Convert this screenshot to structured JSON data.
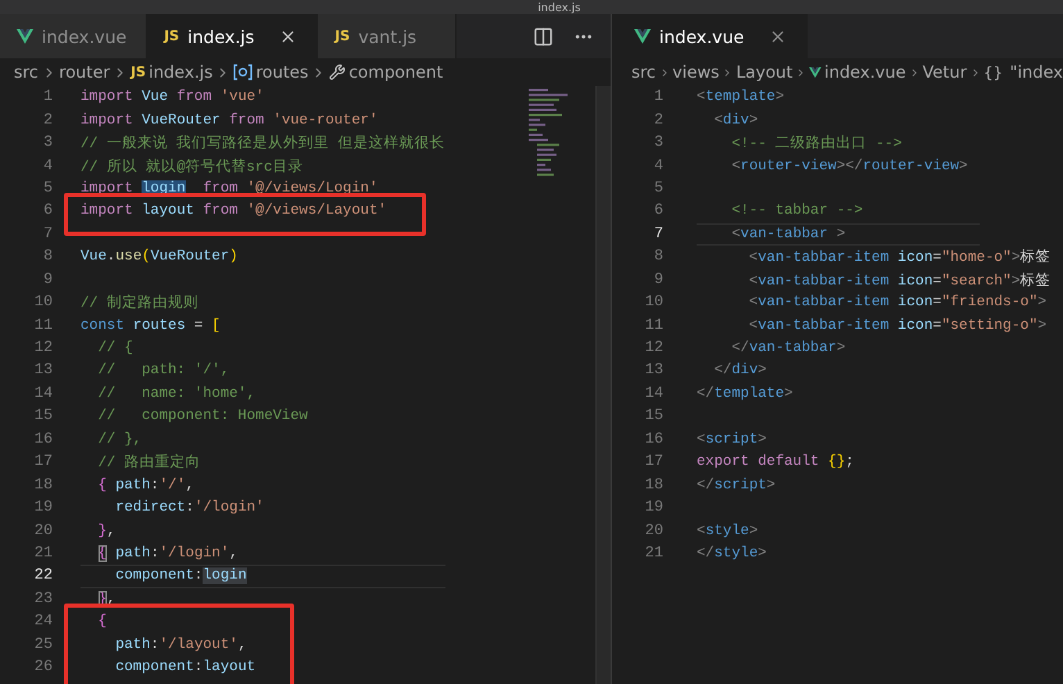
{
  "window": {
    "title": "index.js"
  },
  "left_editor": {
    "tabs": [
      {
        "kind": "vue",
        "label": "index.vue",
        "selected": false
      },
      {
        "kind": "js",
        "badge": "JS",
        "label": "index.js",
        "selected": true
      },
      {
        "kind": "js",
        "badge": "JS",
        "label": "vant.js",
        "selected": false
      }
    ],
    "breadcrumbs": [
      {
        "kind": "folder",
        "text": "src"
      },
      {
        "kind": "folder",
        "text": "router"
      },
      {
        "kind": "js",
        "badge": "JS",
        "text": "index.js"
      },
      {
        "kind": "variable",
        "text": "routes"
      },
      {
        "kind": "property",
        "text": "component"
      }
    ],
    "lines": [
      {
        "n": "1",
        "current": false,
        "marked": false,
        "tokens": [
          {
            "kind": "kw",
            "text": "import "
          },
          {
            "kind": "var",
            "text": "Vue "
          },
          {
            "kind": "kw",
            "text": "from "
          },
          {
            "kind": "str",
            "text": "'vue'"
          }
        ]
      },
      {
        "n": "2",
        "current": false,
        "marked": false,
        "tokens": [
          {
            "kind": "kw",
            "text": "import "
          },
          {
            "kind": "var",
            "text": "VueRouter "
          },
          {
            "kind": "kw",
            "text": "from "
          },
          {
            "kind": "str",
            "text": "'vue-router'"
          }
        ]
      },
      {
        "n": "3",
        "current": false,
        "marked": false,
        "tokens": [
          {
            "kind": "com",
            "text": "// 一般来说 我们写路径是从外到里 但是这样就很长"
          }
        ]
      },
      {
        "n": "4",
        "current": false,
        "marked": false,
        "tokens": [
          {
            "kind": "com",
            "text": "// 所以 就以@符号代替src目录"
          }
        ]
      },
      {
        "n": "5",
        "current": false,
        "marked": false,
        "tokens": [
          {
            "kind": "kw",
            "text": "import "
          },
          {
            "kind": "sel",
            "text": "login"
          },
          {
            "kind": "kw",
            "text": "  from "
          },
          {
            "kind": "str",
            "text": "'@/views/Login'"
          }
        ]
      },
      {
        "n": "6",
        "current": false,
        "marked": true,
        "tokens": [
          {
            "kind": "kw",
            "text": "import "
          },
          {
            "kind": "var",
            "text": "layout "
          },
          {
            "kind": "kw",
            "text": "from "
          },
          {
            "kind": "str",
            "text": "'@/views/Layout'"
          }
        ]
      },
      {
        "n": "7",
        "current": false,
        "marked": false
      },
      {
        "n": "8",
        "current": false,
        "marked": false,
        "tokens": [
          {
            "kind": "var",
            "text": "Vue"
          },
          {
            "kind": "text",
            "text": "."
          },
          {
            "kind": "fn",
            "text": "use"
          },
          {
            "kind": "br1",
            "text": "("
          },
          {
            "kind": "var",
            "text": "VueRouter"
          },
          {
            "kind": "br1",
            "text": ")"
          }
        ]
      },
      {
        "n": "9",
        "current": false,
        "marked": false
      },
      {
        "n": "10",
        "current": false,
        "marked": false,
        "tokens": [
          {
            "kind": "com",
            "text": "// 制定路由规则"
          }
        ]
      },
      {
        "n": "11",
        "current": false,
        "marked": false,
        "tokens": [
          {
            "kind": "const",
            "text": "const "
          },
          {
            "kind": "var",
            "text": "routes "
          },
          {
            "kind": "text",
            "text": "= "
          },
          {
            "kind": "br1",
            "text": "["
          }
        ]
      },
      {
        "n": "12",
        "current": false,
        "marked": false,
        "tokens": [
          {
            "kind": "com",
            "text": "  // {"
          }
        ]
      },
      {
        "n": "13",
        "current": false,
        "marked": false,
        "tokens": [
          {
            "kind": "com",
            "text": "  //   path: '/',"
          }
        ]
      },
      {
        "n": "14",
        "current": false,
        "marked": false,
        "tokens": [
          {
            "kind": "com",
            "text": "  //   name: 'home',"
          }
        ]
      },
      {
        "n": "15",
        "current": false,
        "marked": false,
        "tokens": [
          {
            "kind": "com",
            "text": "  //   component: HomeView"
          }
        ]
      },
      {
        "n": "16",
        "current": false,
        "marked": false,
        "tokens": [
          {
            "kind": "com",
            "text": "  // },"
          }
        ]
      },
      {
        "n": "17",
        "current": false,
        "marked": false,
        "tokens": [
          {
            "kind": "com",
            "text": "  // 路由重定向"
          }
        ]
      },
      {
        "n": "18",
        "current": false,
        "marked": false,
        "tokens": [
          {
            "kind": "br2",
            "text": "  {"
          },
          {
            "kind": "var",
            "text": " path"
          },
          {
            "kind": "text",
            "text": ":"
          },
          {
            "kind": "str",
            "text": "'/'"
          },
          {
            "kind": "text",
            "text": ","
          }
        ]
      },
      {
        "n": "19",
        "current": false,
        "marked": false,
        "tokens": [
          {
            "kind": "var",
            "text": "    redirect"
          },
          {
            "kind": "text",
            "text": ":"
          },
          {
            "kind": "str",
            "text": "'/login'"
          }
        ]
      },
      {
        "n": "20",
        "current": false,
        "marked": false,
        "tokens": [
          {
            "kind": "br2",
            "text": "  }"
          },
          {
            "kind": "text",
            "text": ","
          }
        ]
      },
      {
        "n": "21",
        "current": false,
        "marked": false,
        "tokens": [
          {
            "kind": "match",
            "text": "  {"
          },
          {
            "kind": "var",
            "text": " path"
          },
          {
            "kind": "text",
            "text": ":"
          },
          {
            "kind": "str",
            "text": "'/login'"
          },
          {
            "kind": "text",
            "text": ","
          }
        ]
      },
      {
        "n": "22",
        "current": true,
        "marked": false,
        "tokens": [
          {
            "kind": "var",
            "text": "    component"
          },
          {
            "kind": "text",
            "text": ":"
          },
          {
            "kind": "sel2",
            "text": "login"
          }
        ]
      },
      {
        "n": "23",
        "current": false,
        "marked": false,
        "tokens": [
          {
            "kind": "match",
            "text": "  }"
          },
          {
            "kind": "text",
            "text": ","
          }
        ]
      },
      {
        "n": "24",
        "current": false,
        "marked": true,
        "tokens": [
          {
            "kind": "br2",
            "text": "  {"
          }
        ]
      },
      {
        "n": "25",
        "current": false,
        "marked": true,
        "tokens": [
          {
            "kind": "var",
            "text": "    path"
          },
          {
            "kind": "text",
            "text": ":"
          },
          {
            "kind": "str",
            "text": "'/layout'"
          },
          {
            "kind": "text",
            "text": ","
          }
        ]
      },
      {
        "n": "26",
        "current": false,
        "marked": true,
        "tokens": [
          {
            "kind": "var",
            "text": "    component"
          },
          {
            "kind": "text",
            "text": ":"
          },
          {
            "kind": "var",
            "text": "layout"
          }
        ]
      }
    ]
  },
  "right_editor": {
    "tabs": [
      {
        "kind": "vue",
        "label": "index.vue",
        "selected": true
      }
    ],
    "breadcrumbs": [
      {
        "kind": "folder",
        "text": "src"
      },
      {
        "kind": "folder",
        "text": "views"
      },
      {
        "kind": "folder",
        "text": "Layout"
      },
      {
        "kind": "vue",
        "text": "index.vue"
      },
      {
        "kind": "folder",
        "text": "Vetur"
      },
      {
        "kind": "object",
        "badge": "{}",
        "text": "\"index"
      }
    ],
    "lines": [
      {
        "n": "1",
        "current": false,
        "tokens": [
          {
            "kind": "tag",
            "text": "<"
          },
          {
            "kind": "tagname",
            "text": "template"
          },
          {
            "kind": "tag",
            "text": ">"
          }
        ]
      },
      {
        "n": "2",
        "current": false,
        "tokens": [
          {
            "kind": "tag",
            "text": "  <"
          },
          {
            "kind": "tagname",
            "text": "div"
          },
          {
            "kind": "tag",
            "text": ">"
          }
        ]
      },
      {
        "n": "3",
        "current": false,
        "tokens": [
          {
            "kind": "com",
            "text": "    <!-- 二级路由出口 -->"
          }
        ]
      },
      {
        "n": "4",
        "current": false,
        "tokens": [
          {
            "kind": "tag",
            "text": "    <"
          },
          {
            "kind": "tagname",
            "text": "router-view"
          },
          {
            "kind": "tag",
            "text": "></"
          },
          {
            "kind": "tagname",
            "text": "router-view"
          },
          {
            "kind": "tag",
            "text": ">"
          }
        ]
      },
      {
        "n": "5",
        "current": false
      },
      {
        "n": "6",
        "current": false,
        "tokens": [
          {
            "kind": "com",
            "text": "    <!-- tabbar -->"
          }
        ]
      },
      {
        "n": "7",
        "current": true,
        "tokens": [
          {
            "kind": "tag",
            "text": "    <"
          },
          {
            "kind": "tagname",
            "text": "van-tabbar"
          },
          {
            "kind": "tag",
            "text": " >"
          }
        ]
      },
      {
        "n": "8",
        "current": false,
        "tokens": [
          {
            "kind": "tag",
            "text": "      <"
          },
          {
            "kind": "tagname",
            "text": "van-tabbar-item"
          },
          {
            "kind": "attr",
            "text": " icon"
          },
          {
            "kind": "text",
            "text": "="
          },
          {
            "kind": "str",
            "text": "\"home-o\""
          },
          {
            "kind": "tag",
            "text": ">"
          },
          {
            "kind": "text",
            "text": "标签"
          }
        ]
      },
      {
        "n": "9",
        "current": false,
        "tokens": [
          {
            "kind": "tag",
            "text": "      <"
          },
          {
            "kind": "tagname",
            "text": "van-tabbar-item"
          },
          {
            "kind": "attr",
            "text": " icon"
          },
          {
            "kind": "text",
            "text": "="
          },
          {
            "kind": "str",
            "text": "\"search\""
          },
          {
            "kind": "tag",
            "text": ">"
          },
          {
            "kind": "text",
            "text": "标签"
          }
        ]
      },
      {
        "n": "10",
        "current": false,
        "tokens": [
          {
            "kind": "tag",
            "text": "      <"
          },
          {
            "kind": "tagname",
            "text": "van-tabbar-item"
          },
          {
            "kind": "attr",
            "text": " icon"
          },
          {
            "kind": "text",
            "text": "="
          },
          {
            "kind": "str",
            "text": "\"friends-o\""
          },
          {
            "kind": "tag",
            "text": ">"
          }
        ]
      },
      {
        "n": "11",
        "current": false,
        "tokens": [
          {
            "kind": "tag",
            "text": "      <"
          },
          {
            "kind": "tagname",
            "text": "van-tabbar-item"
          },
          {
            "kind": "attr",
            "text": " icon"
          },
          {
            "kind": "text",
            "text": "="
          },
          {
            "kind": "str",
            "text": "\"setting-o\""
          },
          {
            "kind": "tag",
            "text": ">"
          }
        ]
      },
      {
        "n": "12",
        "current": false,
        "tokens": [
          {
            "kind": "tag",
            "text": "    </"
          },
          {
            "kind": "tagname",
            "text": "van-tabbar"
          },
          {
            "kind": "tag",
            "text": ">"
          }
        ]
      },
      {
        "n": "13",
        "current": false,
        "tokens": [
          {
            "kind": "tag",
            "text": "  </"
          },
          {
            "kind": "tagname",
            "text": "div"
          },
          {
            "kind": "tag",
            "text": ">"
          }
        ]
      },
      {
        "n": "14",
        "current": false,
        "tokens": [
          {
            "kind": "tag",
            "text": "</"
          },
          {
            "kind": "tagname",
            "text": "template"
          },
          {
            "kind": "tag",
            "text": ">"
          }
        ]
      },
      {
        "n": "15",
        "current": false
      },
      {
        "n": "16",
        "current": false,
        "tokens": [
          {
            "kind": "tag",
            "text": "<"
          },
          {
            "kind": "tagname",
            "text": "script"
          },
          {
            "kind": "tag",
            "text": ">"
          }
        ]
      },
      {
        "n": "17",
        "current": false,
        "tokens": [
          {
            "kind": "kw",
            "text": "export default "
          },
          {
            "kind": "br1",
            "text": "{}"
          },
          {
            "kind": "text",
            "text": ";"
          }
        ]
      },
      {
        "n": "18",
        "current": false,
        "tokens": [
          {
            "kind": "tag",
            "text": "</"
          },
          {
            "kind": "tagname",
            "text": "script"
          },
          {
            "kind": "tag",
            "text": ">"
          }
        ]
      },
      {
        "n": "19",
        "current": false
      },
      {
        "n": "20",
        "current": false,
        "tokens": [
          {
            "kind": "tag",
            "text": "<"
          },
          {
            "kind": "tagname",
            "text": "style"
          },
          {
            "kind": "tag",
            "text": ">"
          }
        ]
      },
      {
        "n": "21",
        "current": false,
        "tokens": [
          {
            "kind": "tag",
            "text": "</"
          },
          {
            "kind": "tagname",
            "text": "style"
          },
          {
            "kind": "tag",
            "text": ">"
          }
        ]
      }
    ]
  }
}
